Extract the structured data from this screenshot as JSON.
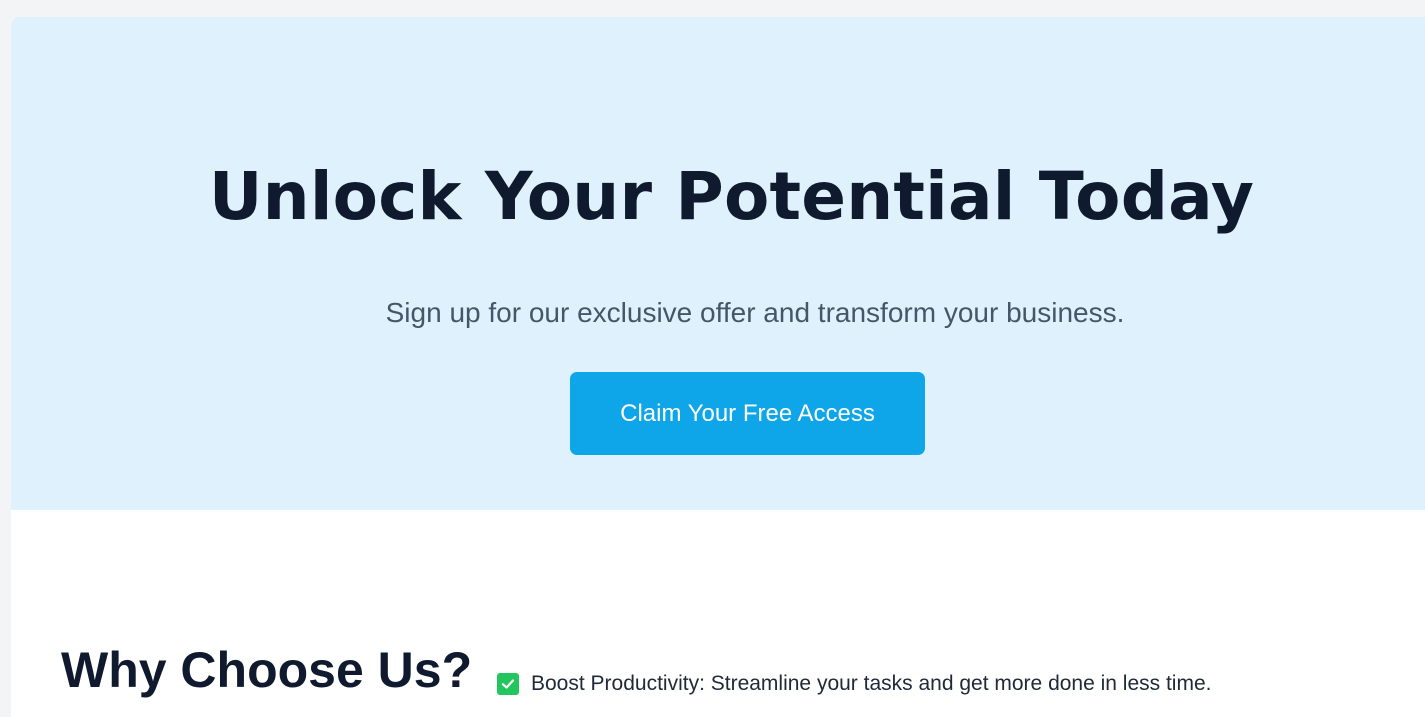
{
  "hero": {
    "title": "Unlock Your Potential Today",
    "subtitle": "Sign up for our exclusive offer and transform your business.",
    "cta_label": "Claim Your Free Access",
    "background_color": "#dff1fd",
    "cta_color": "#0ea5e9"
  },
  "why": {
    "title": "Why Choose Us?",
    "features": [
      {
        "icon": "check-mark-icon",
        "text": "Boost Productivity: Streamline your tasks and get more done in less time."
      }
    ]
  }
}
